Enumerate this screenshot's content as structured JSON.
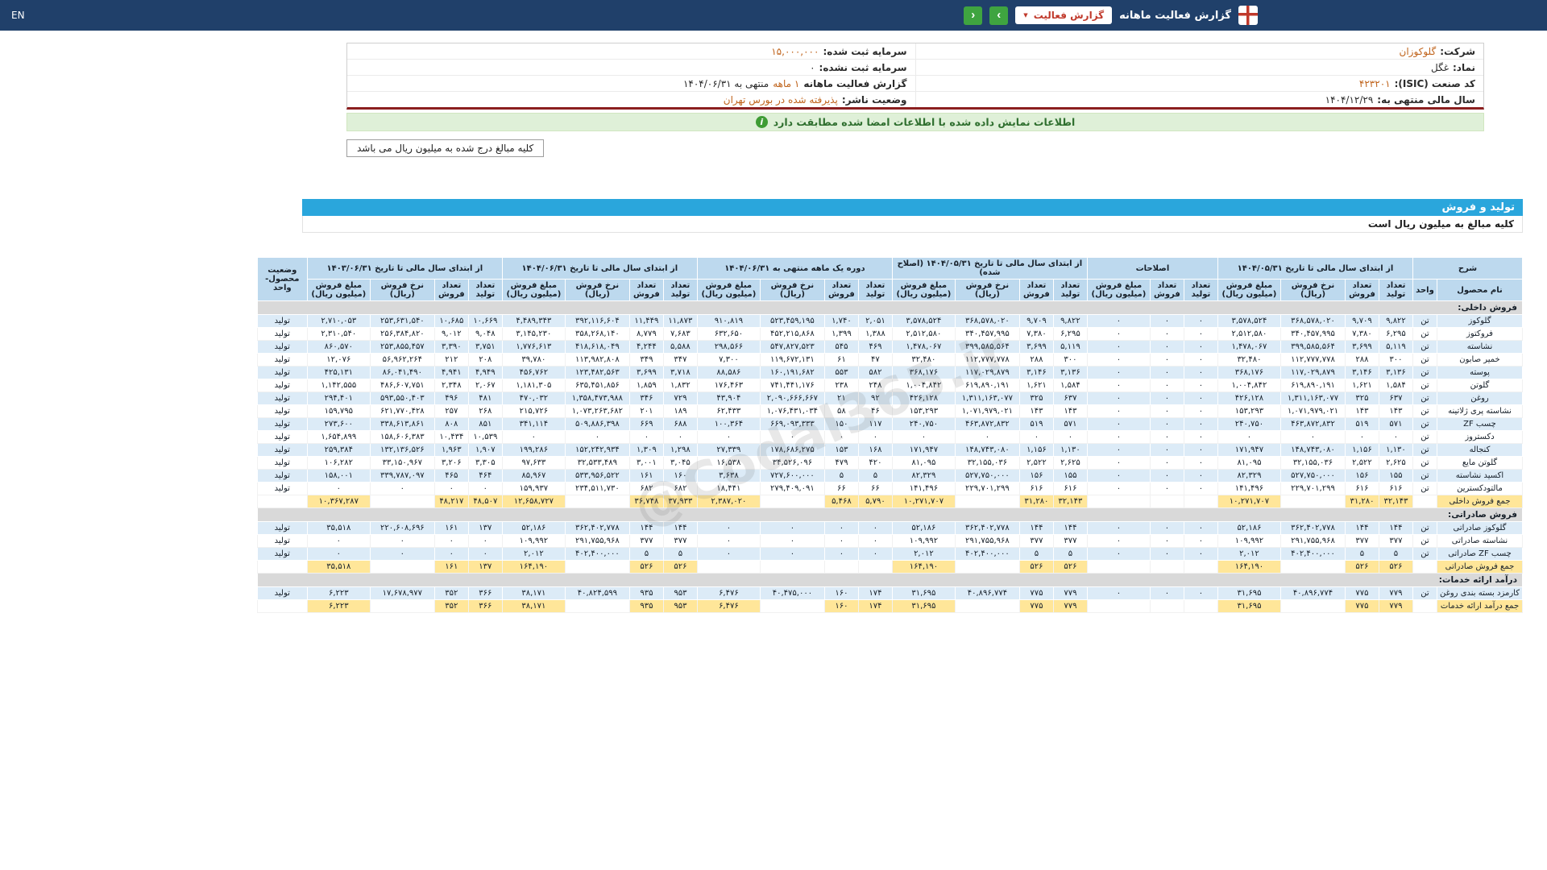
{
  "colors": {
    "topbar": "#20406a",
    "accent_blue": "#2aa6dc",
    "header_blue": "#bdd9ee",
    "row_blue": "#dcebf7",
    "total_yellow": "#ffe699",
    "section_gray": "#d9d9d9",
    "highlight": "#c0641c",
    "green_button": "#3fa440",
    "banner_bg": "#dff0d8",
    "banner_text": "#2f6f2f",
    "red": "#c0392b"
  },
  "navbar": {
    "title": "گزارش فعالیت ماهانه",
    "report_type_label": "گزارش فعالیت",
    "caret": "▼",
    "next_icon": "›",
    "prev_icon": "‹",
    "en_label": "EN"
  },
  "company_info": {
    "right": [
      {
        "label": "شرکت:",
        "value": "گلوکوزان",
        "highlight": true,
        "link": true
      },
      {
        "label": "نماد:",
        "value": "غگل",
        "highlight": false
      },
      {
        "label": "کد صنعت (ISIC):",
        "value": "۴۲۳۲۰۱",
        "highlight": true
      },
      {
        "label": "سال مالی منتهی به:",
        "value": "۱۴۰۴/۱۲/۲۹",
        "highlight": false
      }
    ],
    "left": [
      {
        "label": "سرمایه ثبت شده:",
        "value": "۱۵,۰۰۰,۰۰۰",
        "highlight": true
      },
      {
        "label": "سرمایه ثبت نشده:",
        "value": "۰",
        "highlight": false
      },
      {
        "label": "گزارش فعالیت ماهانه",
        "value": "۱ ماهه",
        "suffix": "منتهی به ۱۴۰۴/۰۶/۳۱",
        "highlight": true
      },
      {
        "label": "وضعیت ناشر:",
        "value": "پذیرفته شده در بورس تهران",
        "highlight": true
      }
    ]
  },
  "signed_banner": {
    "text": "اطلاعات نمایش داده شده با اطلاعات امضا شده مطابقت دارد",
    "icon": "i"
  },
  "amounts_note": "کلیه مبالغ درج شده به میلیون ریال می باشد",
  "section": {
    "title": "تولید و فروش",
    "subtitle": "کلیه مبالغ به میلیون ریال است"
  },
  "watermark": "@Codal365.ir",
  "table": {
    "sharh_header": "شرح",
    "name_header": "نام محصول",
    "unit_header": "واحد",
    "status_header": "وضعیت محصول-واحد",
    "sub_cols4": [
      "تعداد تولید",
      "تعداد فروش",
      "نرخ فروش (ریال)",
      "مبلغ فروش (میلیون ریال)"
    ],
    "sub_cols3": [
      "تعداد تولید",
      "تعداد فروش",
      "مبلغ فروش (میلیون ریال)"
    ],
    "groups": [
      {
        "title": "از ابتدای سال مالی تا تاریخ ۱۴۰۴/۰۵/۳۱",
        "cols": 4
      },
      {
        "title": "اصلاحات",
        "cols": 3
      },
      {
        "title": "از ابتدای سال مالی تا تاریخ ۱۴۰۴/۰۵/۳۱ (اصلاح شده)",
        "cols": 4
      },
      {
        "title": "دوره یک ماهه منتهی به ۱۴۰۴/۰۶/۳۱",
        "cols": 4
      },
      {
        "title": "از ابتدای سال مالی تا تاریخ ۱۴۰۴/۰۶/۳۱",
        "cols": 4
      },
      {
        "title": "از ابتدای سال مالی تا تاریخ ۱۴۰۳/۰۶/۳۱",
        "cols": 4
      }
    ],
    "rows": [
      {
        "type": "section",
        "name": "فروش داخلی:"
      },
      {
        "type": "data",
        "name": "گلوکوز",
        "unit": "تن",
        "status": "تولید",
        "cells": [
          "۹,۸۲۲",
          "۹,۷۰۹",
          "۳۶۸,۵۷۸,۰۲۰",
          "۳,۵۷۸,۵۲۴",
          "۰",
          "۰",
          "۰",
          "۹,۸۲۲",
          "۹,۷۰۹",
          "۳۶۸,۵۷۸,۰۲۰",
          "۳,۵۷۸,۵۲۴",
          "۲,۰۵۱",
          "۱,۷۴۰",
          "۵۲۳,۴۵۹,۱۹۵",
          "۹۱۰,۸۱۹",
          "۱۱,۸۷۳",
          "۱۱,۴۴۹",
          "۳۹۲,۱۱۶,۶۰۴",
          "۴,۴۸۹,۳۴۳",
          "۱۰,۶۶۹",
          "۱۰,۶۸۵",
          "۲۵۳,۶۳۱,۵۴۰",
          "۲,۷۱۰,۰۵۳"
        ]
      },
      {
        "type": "data",
        "name": "فروکتوز",
        "unit": "تن",
        "status": "تولید",
        "cells": [
          "۶,۲۹۵",
          "۷,۳۸۰",
          "۳۴۰,۴۵۷,۹۹۵",
          "۲,۵۱۲,۵۸۰",
          "۰",
          "۰",
          "۰",
          "۶,۲۹۵",
          "۷,۳۸۰",
          "۳۴۰,۴۵۷,۹۹۵",
          "۲,۵۱۲,۵۸۰",
          "۱,۳۸۸",
          "۱,۳۹۹",
          "۴۵۲,۲۱۵,۸۶۸",
          "۶۳۲,۶۵۰",
          "۷,۶۸۳",
          "۸,۷۷۹",
          "۳۵۸,۲۶۸,۱۴۰",
          "۳,۱۴۵,۲۳۰",
          "۹,۰۴۸",
          "۹,۰۱۲",
          "۲۵۶,۳۸۴,۸۲۰",
          "۲,۳۱۰,۵۴۰"
        ]
      },
      {
        "type": "data",
        "name": "نشاسته",
        "unit": "تن",
        "status": "تولید",
        "cells": [
          "۵,۱۱۹",
          "۳,۶۹۹",
          "۳۹۹,۵۸۵,۵۶۴",
          "۱,۴۷۸,۰۶۷",
          "۰",
          "۰",
          "۰",
          "۵,۱۱۹",
          "۳,۶۹۹",
          "۳۹۹,۵۸۵,۵۶۴",
          "۱,۴۷۸,۰۶۷",
          "۴۶۹",
          "۵۴۵",
          "۵۴۷,۸۲۷,۵۲۳",
          "۲۹۸,۵۶۶",
          "۵,۵۸۸",
          "۴,۲۴۴",
          "۴۱۸,۶۱۸,۰۴۹",
          "۱,۷۷۶,۶۱۳",
          "۳,۷۵۱",
          "۳,۳۹۰",
          "۲۵۳,۸۵۵,۴۵۷",
          "۸۶۰,۵۷۰"
        ]
      },
      {
        "type": "data",
        "name": "خمیر صابون",
        "unit": "تن",
        "status": "تولید",
        "cells": [
          "۳۰۰",
          "۲۸۸",
          "۱۱۲,۷۷۷,۷۷۸",
          "۳۲,۴۸۰",
          "۰",
          "۰",
          "۰",
          "۳۰۰",
          "۲۸۸",
          "۱۱۲,۷۷۷,۷۷۸",
          "۳۲,۴۸۰",
          "۴۷",
          "۶۱",
          "۱۱۹,۶۷۲,۱۳۱",
          "۷,۳۰۰",
          "۳۴۷",
          "۳۴۹",
          "۱۱۳,۹۸۲,۸۰۸",
          "۳۹,۷۸۰",
          "۲۰۸",
          "۲۱۲",
          "۵۶,۹۶۲,۲۶۴",
          "۱۲,۰۷۶"
        ]
      },
      {
        "type": "data",
        "name": "پوسته",
        "unit": "تن",
        "status": "تولید",
        "cells": [
          "۳,۱۳۶",
          "۳,۱۴۶",
          "۱۱۷,۰۲۹,۸۷۹",
          "۳۶۸,۱۷۶",
          "۰",
          "۰",
          "۰",
          "۳,۱۳۶",
          "۳,۱۴۶",
          "۱۱۷,۰۲۹,۸۷۹",
          "۳۶۸,۱۷۶",
          "۵۸۲",
          "۵۵۳",
          "۱۶۰,۱۹۱,۶۸۲",
          "۸۸,۵۸۶",
          "۳,۷۱۸",
          "۳,۶۹۹",
          "۱۲۳,۴۸۲,۵۶۳",
          "۴۵۶,۷۶۲",
          "۴,۹۴۹",
          "۴,۹۴۱",
          "۸۶,۰۴۱,۴۹۰",
          "۴۲۵,۱۳۱"
        ]
      },
      {
        "type": "data",
        "name": "گلوتن",
        "unit": "تن",
        "status": "تولید",
        "cells": [
          "۱,۵۸۴",
          "۱,۶۲۱",
          "۶۱۹,۸۹۰,۱۹۱",
          "۱,۰۰۴,۸۴۲",
          "۰",
          "۰",
          "۰",
          "۱,۵۸۴",
          "۱,۶۲۱",
          "۶۱۹,۸۹۰,۱۹۱",
          "۱,۰۰۴,۸۴۲",
          "۲۴۸",
          "۲۳۸",
          "۷۴۱,۴۴۱,۱۷۶",
          "۱۷۶,۴۶۳",
          "۱,۸۳۲",
          "۱,۸۵۹",
          "۶۳۵,۴۵۱,۸۵۶",
          "۱,۱۸۱,۳۰۵",
          "۲,۰۶۷",
          "۲,۳۴۸",
          "۴۸۶,۶۰۷,۷۵۱",
          "۱,۱۴۲,۵۵۵"
        ]
      },
      {
        "type": "data",
        "name": "روغن",
        "unit": "تن",
        "status": "تولید",
        "cells": [
          "۶۳۷",
          "۳۲۵",
          "۱,۳۱۱,۱۶۳,۰۷۷",
          "۴۲۶,۱۲۸",
          "۰",
          "۰",
          "۰",
          "۶۳۷",
          "۳۲۵",
          "۱,۳۱۱,۱۶۳,۰۷۷",
          "۴۲۶,۱۲۸",
          "۹۲",
          "۲۱",
          "۲,۰۹۰,۶۶۶,۶۶۷",
          "۴۳,۹۰۴",
          "۷۲۹",
          "۳۴۶",
          "۱,۳۵۸,۴۷۳,۹۸۸",
          "۴۷۰,۰۳۲",
          "۴۸۱",
          "۴۹۶",
          "۵۹۳,۵۵۰,۴۰۳",
          "۲۹۴,۴۰۱"
        ]
      },
      {
        "type": "data",
        "name": "نشاسته پری ژلاتینه",
        "unit": "تن",
        "status": "تولید",
        "cells": [
          "۱۴۳",
          "۱۴۳",
          "۱,۰۷۱,۹۷۹,۰۲۱",
          "۱۵۳,۲۹۳",
          "۰",
          "۰",
          "۰",
          "۱۴۳",
          "۱۴۳",
          "۱,۰۷۱,۹۷۹,۰۲۱",
          "۱۵۳,۲۹۳",
          "۴۶",
          "۵۸",
          "۱,۰۷۶,۴۳۱,۰۳۴",
          "۶۲,۴۳۳",
          "۱۸۹",
          "۲۰۱",
          "۱,۰۷۳,۲۶۳,۶۸۲",
          "۲۱۵,۷۲۶",
          "۲۶۸",
          "۲۵۷",
          "۶۲۱,۷۷۰,۴۲۸",
          "۱۵۹,۷۹۵"
        ]
      },
      {
        "type": "data",
        "name": "چسب ZF",
        "unit": "تن",
        "status": "تولید",
        "cells": [
          "۵۷۱",
          "۵۱۹",
          "۴۶۳,۸۷۲,۸۳۲",
          "۲۴۰,۷۵۰",
          "۰",
          "۰",
          "۰",
          "۵۷۱",
          "۵۱۹",
          "۴۶۳,۸۷۲,۸۳۲",
          "۲۴۰,۷۵۰",
          "۱۱۷",
          "۱۵۰",
          "۶۶۹,۰۹۳,۳۳۳",
          "۱۰۰,۳۶۴",
          "۶۸۸",
          "۶۶۹",
          "۵۰۹,۸۸۶,۳۹۸",
          "۳۴۱,۱۱۴",
          "۸۵۱",
          "۸۰۸",
          "۳۳۸,۶۱۳,۸۶۱",
          "۲۷۳,۶۰۰"
        ]
      },
      {
        "type": "data",
        "name": "دکستروز",
        "unit": "تن",
        "status": "تولید",
        "cells": [
          "۰",
          "۰",
          "۰",
          "۰",
          "۰",
          "۰",
          "۰",
          "۰",
          "۰",
          "۰",
          "۰",
          "۰",
          "۰",
          "۰",
          "۰",
          "۰",
          "۰",
          "۰",
          "۰",
          "۱۰,۵۳۹",
          "۱۰,۴۳۴",
          "۱۵۸,۶۰۶,۳۸۳",
          "۱,۶۵۴,۸۹۹"
        ]
      },
      {
        "type": "data",
        "name": "کنجاله",
        "unit": "تن",
        "status": "تولید",
        "cells": [
          "۱,۱۳۰",
          "۱,۱۵۶",
          "۱۴۸,۷۴۳,۰۸۰",
          "۱۷۱,۹۴۷",
          "۰",
          "۰",
          "۰",
          "۱,۱۳۰",
          "۱,۱۵۶",
          "۱۴۸,۷۴۳,۰۸۰",
          "۱۷۱,۹۴۷",
          "۱۶۸",
          "۱۵۳",
          "۱۷۸,۶۸۶,۲۷۵",
          "۲۷,۳۳۹",
          "۱,۲۹۸",
          "۱,۳۰۹",
          "۱۵۲,۲۴۲,۹۳۴",
          "۱۹۹,۲۸۶",
          "۱,۹۰۷",
          "۱,۹۶۳",
          "۱۳۲,۱۳۶,۵۲۶",
          "۲۵۹,۳۸۴"
        ]
      },
      {
        "type": "data",
        "name": "گلوتن مایع",
        "unit": "تن",
        "status": "تولید",
        "cells": [
          "۲,۶۲۵",
          "۲,۵۲۲",
          "۳۲,۱۵۵,۰۳۶",
          "۸۱,۰۹۵",
          "۰",
          "۰",
          "۰",
          "۲,۶۲۵",
          "۲,۵۲۲",
          "۳۲,۱۵۵,۰۳۶",
          "۸۱,۰۹۵",
          "۴۲۰",
          "۴۷۹",
          "۳۴,۵۲۶,۰۹۶",
          "۱۶,۵۳۸",
          "۳,۰۴۵",
          "۳,۰۰۱",
          "۳۲,۵۳۳,۴۸۹",
          "۹۷,۶۳۳",
          "۳,۳۰۵",
          "۳,۲۰۶",
          "۳۳,۱۵۰,۹۶۷",
          "۱۰۶,۲۸۲"
        ]
      },
      {
        "type": "data",
        "name": "اکسید نشاسته",
        "unit": "تن",
        "status": "تولید",
        "cells": [
          "۱۵۵",
          "۱۵۶",
          "۵۲۷,۷۵۰,۰۰۰",
          "۸۲,۳۲۹",
          "۰",
          "۰",
          "۰",
          "۱۵۵",
          "۱۵۶",
          "۵۲۷,۷۵۰,۰۰۰",
          "۸۲,۳۲۹",
          "۵",
          "۵",
          "۷۲۷,۶۰۰,۰۰۰",
          "۳,۶۳۸",
          "۱۶۰",
          "۱۶۱",
          "۵۳۳,۹۵۶,۵۲۲",
          "۸۵,۹۶۷",
          "۴۶۴",
          "۴۶۵",
          "۳۳۹,۷۸۷,۰۹۷",
          "۱۵۸,۰۰۱"
        ]
      },
      {
        "type": "data",
        "name": "مالتودکسترین",
        "unit": "تن",
        "status": "تولید",
        "cells": [
          "۶۱۶",
          "۶۱۶",
          "۲۲۹,۷۰۱,۲۹۹",
          "۱۴۱,۴۹۶",
          "۰",
          "۰",
          "۰",
          "۶۱۶",
          "۶۱۶",
          "۲۲۹,۷۰۱,۲۹۹",
          "۱۴۱,۴۹۶",
          "۶۶",
          "۶۶",
          "۲۷۹,۴۰۹,۰۹۱",
          "۱۸,۴۴۱",
          "۶۸۲",
          "۶۸۲",
          "۲۳۴,۵۱۱,۷۳۰",
          "۱۵۹,۹۳۷",
          "۰",
          "۰",
          "۰",
          "۰"
        ]
      },
      {
        "type": "total",
        "name": "جمع فروش داخلی",
        "unit": "",
        "status": "",
        "cells": [
          "۳۲,۱۴۳",
          "۳۱,۲۸۰",
          "",
          "۱۰,۲۷۱,۷۰۷",
          "",
          "",
          "",
          "۳۲,۱۴۳",
          "۳۱,۲۸۰",
          "",
          "۱۰,۲۷۱,۷۰۷",
          "۵,۷۹۰",
          "۵,۴۶۸",
          "",
          "۲,۳۸۷,۰۲۰",
          "۳۷,۹۳۳",
          "۳۶,۷۴۸",
          "",
          "۱۲,۶۵۸,۷۲۷",
          "۴۸,۵۰۷",
          "۴۸,۲۱۷",
          "",
          "۱۰,۳۶۷,۲۸۷"
        ]
      },
      {
        "type": "section",
        "name": "فروش صادراتی:"
      },
      {
        "type": "data",
        "name": "گلوکوز صادراتی",
        "unit": "تن",
        "status": "تولید",
        "cells": [
          "۱۴۴",
          "۱۴۴",
          "۳۶۲,۴۰۲,۷۷۸",
          "۵۲,۱۸۶",
          "۰",
          "۰",
          "۰",
          "۱۴۴",
          "۱۴۴",
          "۳۶۲,۴۰۲,۷۷۸",
          "۵۲,۱۸۶",
          "۰",
          "۰",
          "۰",
          "۰",
          "۱۴۴",
          "۱۴۴",
          "۳۶۲,۴۰۲,۷۷۸",
          "۵۲,۱۸۶",
          "۱۳۷",
          "۱۶۱",
          "۲۲۰,۶۰۸,۶۹۶",
          "۳۵,۵۱۸"
        ]
      },
      {
        "type": "data",
        "name": "نشاسته صادراتی",
        "unit": "تن",
        "status": "تولید",
        "cells": [
          "۳۷۷",
          "۳۷۷",
          "۲۹۱,۷۵۵,۹۶۸",
          "۱۰۹,۹۹۲",
          "۰",
          "۰",
          "۰",
          "۳۷۷",
          "۳۷۷",
          "۲۹۱,۷۵۵,۹۶۸",
          "۱۰۹,۹۹۲",
          "۰",
          "۰",
          "۰",
          "۰",
          "۳۷۷",
          "۳۷۷",
          "۲۹۱,۷۵۵,۹۶۸",
          "۱۰۹,۹۹۲",
          "۰",
          "۰",
          "۰",
          "۰"
        ]
      },
      {
        "type": "data",
        "name": "چسب ZF صادراتی",
        "unit": "تن",
        "status": "تولید",
        "cells": [
          "۵",
          "۵",
          "۴۰۲,۴۰۰,۰۰۰",
          "۲,۰۱۲",
          "۰",
          "۰",
          "۰",
          "۵",
          "۵",
          "۴۰۲,۴۰۰,۰۰۰",
          "۲,۰۱۲",
          "۰",
          "۰",
          "۰",
          "۰",
          "۵",
          "۵",
          "۴۰۲,۴۰۰,۰۰۰",
          "۲,۰۱۲",
          "۰",
          "۰",
          "۰",
          "۰"
        ]
      },
      {
        "type": "total",
        "name": "جمع فروش صادراتی",
        "unit": "",
        "status": "",
        "cells": [
          "۵۲۶",
          "۵۲۶",
          "",
          "۱۶۴,۱۹۰",
          "",
          "",
          "",
          "۵۲۶",
          "۵۲۶",
          "",
          "۱۶۴,۱۹۰",
          "",
          "",
          "",
          "",
          "۵۲۶",
          "۵۲۶",
          "",
          "۱۶۴,۱۹۰",
          "۱۳۷",
          "۱۶۱",
          "",
          "۳۵,۵۱۸"
        ]
      },
      {
        "type": "section",
        "name": "درآمد ارائه خدمات:"
      },
      {
        "type": "data",
        "name": "کارمزد بسته بندی روغن",
        "unit": "تن",
        "status": "تولید",
        "cells": [
          "۷۷۹",
          "۷۷۵",
          "۴۰,۸۹۶,۷۷۴",
          "۳۱,۶۹۵",
          "۰",
          "۰",
          "۰",
          "۷۷۹",
          "۷۷۵",
          "۴۰,۸۹۶,۷۷۴",
          "۳۱,۶۹۵",
          "۱۷۴",
          "۱۶۰",
          "۴۰,۴۷۵,۰۰۰",
          "۶,۴۷۶",
          "۹۵۳",
          "۹۳۵",
          "۴۰,۸۲۴,۵۹۹",
          "۳۸,۱۷۱",
          "۳۶۶",
          "۳۵۲",
          "۱۷,۶۷۸,۹۷۷",
          "۶,۲۲۳"
        ]
      },
      {
        "type": "total",
        "name": "جمع درآمد ارائه خدمات",
        "unit": "",
        "status": "",
        "cells": [
          "۷۷۹",
          "۷۷۵",
          "",
          "۳۱,۶۹۵",
          "",
          "",
          "",
          "۷۷۹",
          "۷۷۵",
          "",
          "۳۱,۶۹۵",
          "۱۷۴",
          "۱۶۰",
          "",
          "۶,۴۷۶",
          "۹۵۳",
          "۹۳۵",
          "",
          "۳۸,۱۷۱",
          "۳۶۶",
          "۳۵۲",
          "",
          "۶,۲۲۳"
        ]
      }
    ]
  }
}
